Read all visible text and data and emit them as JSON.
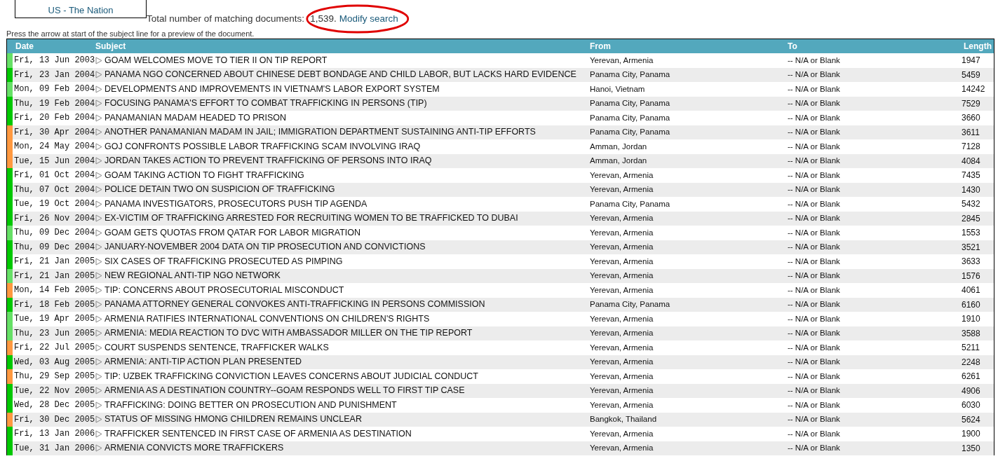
{
  "source_box": {
    "link": "US - The Nation"
  },
  "summary": {
    "text": "Total number of matching documents:",
    "count": "1,539.",
    "link": "Modify search"
  },
  "hint": "Press the arrow at start of the subject line for a preview of the document.",
  "table": {
    "columns": [
      "Date",
      "Subject",
      "From",
      "To",
      "Length"
    ],
    "rows": [
      {
        "color": "#66e066",
        "date": "Fri, 13 Jun 2003",
        "subject": "GOAM WELCOMES MOVE TO TIER II ON TIP REPORT",
        "from": "Yerevan, Armenia",
        "to": "-- N/A or Blank",
        "length": "1947"
      },
      {
        "color": "#00c800",
        "date": "Fri, 23 Jan 2004",
        "subject": "PANAMA NGO CONCERNED ABOUT CHINESE DEBT BONDAGE AND CHILD LABOR, BUT LACKS HARD EVIDENCE",
        "from": "Panama City, Panama",
        "to": "-- N/A or Blank",
        "length": "5459"
      },
      {
        "color": "#66e066",
        "date": "Mon, 09 Feb 2004",
        "subject": "DEVELOPMENTS AND IMPROVEMENTS IN VIETNAM'S LABOR EXPORT SYSTEM",
        "from": "Hanoi, Vietnam",
        "to": "-- N/A or Blank",
        "length": "14242"
      },
      {
        "color": "#00c800",
        "date": "Thu, 19 Feb 2004",
        "subject": "FOCUSING PANAMA'S EFFORT TO COMBAT TRAFFICKING IN PERSONS (TIP)",
        "from": "Panama City, Panama",
        "to": "-- N/A or Blank",
        "length": "7529"
      },
      {
        "color": "#00c800",
        "date": "Fri, 20 Feb 2004",
        "subject": "PANAMANIAN MADAM HEADED TO PRISON",
        "from": "Panama City, Panama",
        "to": "-- N/A or Blank",
        "length": "3660"
      },
      {
        "color": "#ff9940",
        "date": "Fri, 30 Apr 2004",
        "subject": "ANOTHER PANAMANIAN MADAM IN JAIL; IMMIGRATION DEPARTMENT SUSTAINING ANTI-TIP EFFORTS",
        "from": "Panama City, Panama",
        "to": "-- N/A or Blank",
        "length": "3611"
      },
      {
        "color": "#ff9940",
        "date": "Mon, 24 May 2004",
        "subject": "GOJ CONFRONTS POSSIBLE LABOR TRAFFICKING SCAM INVOLVING IRAQ",
        "from": "Amman, Jordan",
        "to": "-- N/A or Blank",
        "length": "7128"
      },
      {
        "color": "#ff9940",
        "date": "Tue, 15 Jun 2004",
        "subject": "JORDAN TAKES ACTION TO PREVENT TRAFFICKING OF PERSONS INTO IRAQ",
        "from": "Amman, Jordan",
        "to": "-- N/A or Blank",
        "length": "4084"
      },
      {
        "color": "#00c800",
        "date": "Fri, 01 Oct 2004",
        "subject": "GOAM TAKING ACTION TO FIGHT TRAFFICKING",
        "from": "Yerevan, Armenia",
        "to": "-- N/A or Blank",
        "length": "7435"
      },
      {
        "color": "#00c800",
        "date": "Thu, 07 Oct 2004",
        "subject": "POLICE DETAIN TWO ON SUSPICION OF TRAFFICKING",
        "from": "Yerevan, Armenia",
        "to": "-- N/A or Blank",
        "length": "1430"
      },
      {
        "color": "#00c800",
        "date": "Tue, 19 Oct 2004",
        "subject": "PANAMA INVESTIGATORS, PROSECUTORS PUSH TIP AGENDA",
        "from": "Panama City, Panama",
        "to": "-- N/A or Blank",
        "length": "5432"
      },
      {
        "color": "#00c800",
        "date": "Fri, 26 Nov 2004",
        "subject": "EX-VICTIM OF TRAFFICKING ARRESTED FOR RECRUITING WOMEN TO BE TRAFFICKED TO DUBAI",
        "from": "Yerevan, Armenia",
        "to": "-- N/A or Blank",
        "length": "2845"
      },
      {
        "color": "#66e066",
        "date": "Thu, 09 Dec 2004",
        "subject": "GOAM GETS QUOTAS FROM QATAR FOR LABOR MIGRATION",
        "from": "Yerevan, Armenia",
        "to": "-- N/A or Blank",
        "length": "1553"
      },
      {
        "color": "#00c800",
        "date": "Thu, 09 Dec 2004",
        "subject": "JANUARY-NOVEMBER 2004 DATA ON TIP PROSECUTION AND CONVICTIONS",
        "from": "Yerevan, Armenia",
        "to": "-- N/A or Blank",
        "length": "3521"
      },
      {
        "color": "#00c800",
        "date": "Fri, 21 Jan 2005",
        "subject": "SIX CASES OF TRAFFICKING PROSECUTED AS PIMPING",
        "from": "Yerevan, Armenia",
        "to": "-- N/A or Blank",
        "length": "3633"
      },
      {
        "color": "#66e066",
        "date": "Fri, 21 Jan 2005",
        "subject": "NEW REGIONAL ANTI-TIP NGO NETWORK",
        "from": "Yerevan, Armenia",
        "to": "-- N/A or Blank",
        "length": "1576"
      },
      {
        "color": "#ff9940",
        "date": "Mon, 14 Feb 2005",
        "subject": "TIP: CONCERNS ABOUT PROSECUTORIAL MISCONDUCT",
        "from": "Yerevan, Armenia",
        "to": "-- N/A or Blank",
        "length": "4061"
      },
      {
        "color": "#00c800",
        "date": "Fri, 18 Feb 2005",
        "subject": "PANAMA ATTORNEY GENERAL CONVOKES ANTI-TRAFFICKING IN PERSONS COMMISSION",
        "from": "Panama City, Panama",
        "to": "-- N/A or Blank",
        "length": "6160"
      },
      {
        "color": "#66e066",
        "date": "Tue, 19 Apr 2005",
        "subject": "ARMENIA RATIFIES INTERNATIONAL CONVENTIONS ON CHILDREN'S RIGHTS",
        "from": "Yerevan, Armenia",
        "to": "-- N/A or Blank",
        "length": "1910"
      },
      {
        "color": "#66e066",
        "date": "Thu, 23 Jun 2005",
        "subject": "ARMENIA: MEDIA REACTION TO DVC WITH AMBASSADOR MILLER ON THE TIP REPORT",
        "from": "Yerevan, Armenia",
        "to": "-- N/A or Blank",
        "length": "3588"
      },
      {
        "color": "#ff9940",
        "date": "Fri, 22 Jul 2005",
        "subject": "COURT SUSPENDS SENTENCE, TRAFFICKER WALKS",
        "from": "Yerevan, Armenia",
        "to": "-- N/A or Blank",
        "length": "5211"
      },
      {
        "color": "#00c800",
        "date": "Wed, 03 Aug 2005",
        "subject": "ARMENIA: ANTI-TIP ACTION PLAN PRESENTED",
        "from": "Yerevan, Armenia",
        "to": "-- N/A or Blank",
        "length": "2248"
      },
      {
        "color": "#ff9940",
        "date": "Thu, 29 Sep 2005",
        "subject": "TIP: UZBEK TRAFFICKING CONVICTION LEAVES CONCERNS ABOUT JUDICIAL CONDUCT",
        "from": "Yerevan, Armenia",
        "to": "-- N/A or Blank",
        "length": "6261"
      },
      {
        "color": "#00c800",
        "date": "Tue, 22 Nov 2005",
        "subject": "ARMENIA AS A DESTINATION COUNTRY--GOAM RESPONDS WELL TO FIRST TIP CASE",
        "from": "Yerevan, Armenia",
        "to": "-- N/A or Blank",
        "length": "4906"
      },
      {
        "color": "#00c800",
        "date": "Wed, 28 Dec 2005",
        "subject": "TRAFFICKING: DOING BETTER ON PROSECUTION AND PUNISHMENT",
        "from": "Yerevan, Armenia",
        "to": "-- N/A or Blank",
        "length": "6030"
      },
      {
        "color": "#ff9940",
        "date": "Fri, 30 Dec 2005",
        "subject": "STATUS OF MISSING HMONG CHILDREN REMAINS UNCLEAR",
        "from": "Bangkok, Thailand",
        "to": "-- N/A or Blank",
        "length": "5624"
      },
      {
        "color": "#00c800",
        "date": "Fri, 13 Jan 2006",
        "subject": "TRAFFICKER SENTENCED IN FIRST CASE OF ARMENIA AS DESTINATION",
        "from": "Yerevan, Armenia",
        "to": "-- N/A or Blank",
        "length": "1900"
      },
      {
        "color": "#00c800",
        "date": "Tue, 31 Jan 2006",
        "subject": "ARMENIA CONVICTS MORE TRAFFICKERS",
        "from": "Yerevan, Armenia",
        "to": "-- N/A or Blank",
        "length": "1350"
      }
    ]
  }
}
